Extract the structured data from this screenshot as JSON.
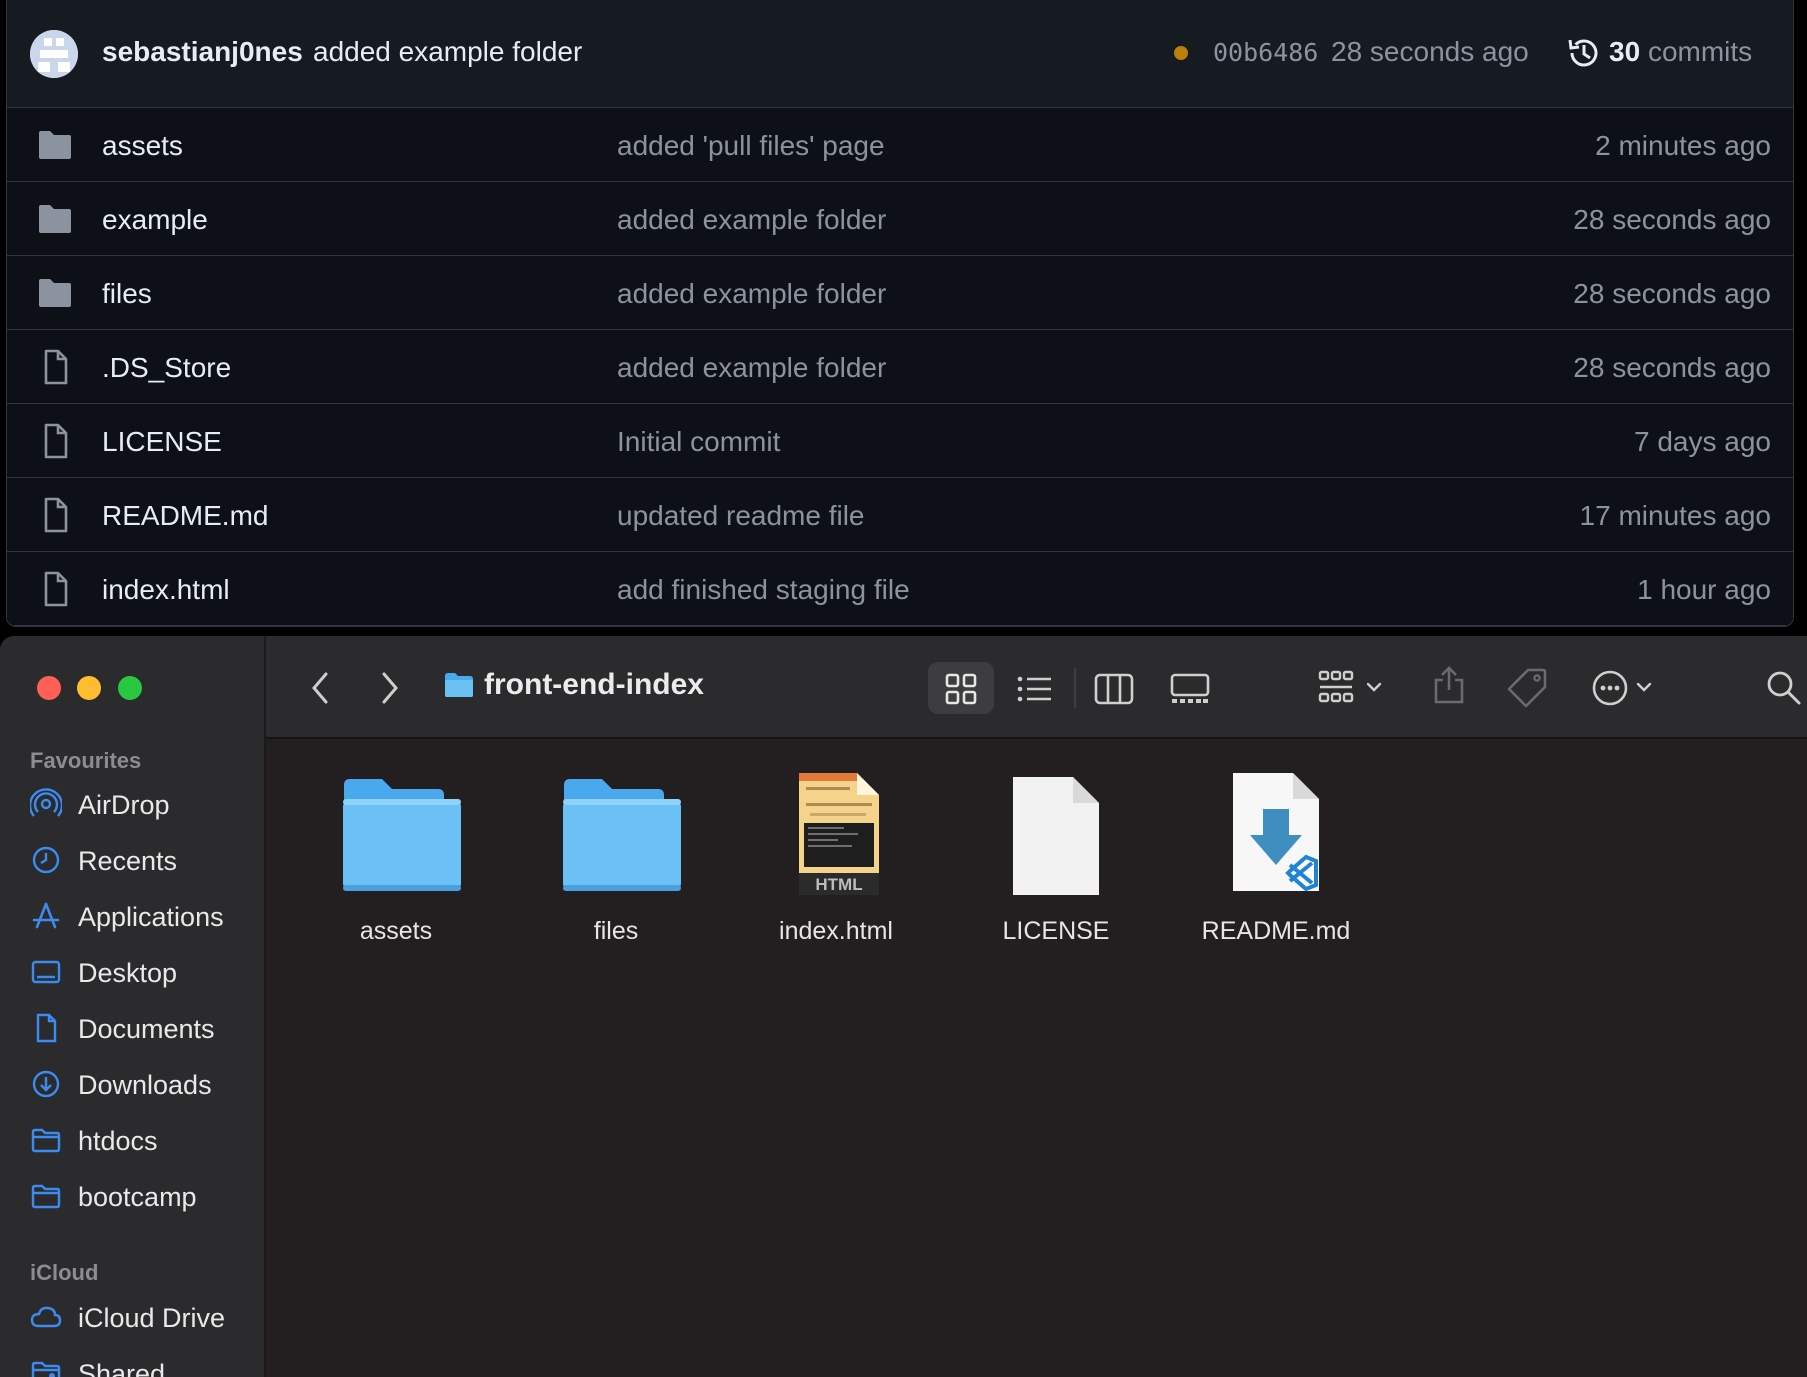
{
  "github": {
    "last_commit": {
      "author": "sebastianj0nes",
      "message": "added example folder",
      "sha": "00b6486",
      "time": "28 seconds ago",
      "commits_count": "30",
      "commits_label": "commits"
    },
    "files": [
      {
        "name": "assets",
        "type": "folder",
        "message": "added 'pull files' page",
        "age": "2 minutes ago"
      },
      {
        "name": "example",
        "type": "folder",
        "message": "added example folder",
        "age": "28 seconds ago"
      },
      {
        "name": "files",
        "type": "folder",
        "message": "added example folder",
        "age": "28 seconds ago"
      },
      {
        "name": ".DS_Store",
        "type": "file",
        "message": "added example folder",
        "age": "28 seconds ago"
      },
      {
        "name": "LICENSE",
        "type": "file",
        "message": "Initial commit",
        "age": "7 days ago"
      },
      {
        "name": "README.md",
        "type": "file",
        "message": "updated readme file",
        "age": "17 minutes ago"
      },
      {
        "name": "index.html",
        "type": "file",
        "message": "add finished staging file",
        "age": "1 hour ago"
      }
    ]
  },
  "finder": {
    "folder_title": "front-end-index",
    "sidebar": {
      "favourites_label": "Favourites",
      "favourites": [
        {
          "label": "AirDrop",
          "icon": "airdrop-icon"
        },
        {
          "label": "Recents",
          "icon": "clock-icon"
        },
        {
          "label": "Applications",
          "icon": "applications-icon"
        },
        {
          "label": "Desktop",
          "icon": "desktop-icon"
        },
        {
          "label": "Documents",
          "icon": "document-icon"
        },
        {
          "label": "Downloads",
          "icon": "download-icon"
        },
        {
          "label": "htdocs",
          "icon": "folder-icon"
        },
        {
          "label": "bootcamp",
          "icon": "folder-icon"
        }
      ],
      "icloud_label": "iCloud",
      "icloud": [
        {
          "label": "iCloud Drive",
          "icon": "cloud-icon"
        },
        {
          "label": "Shared",
          "icon": "shared-folder-icon"
        }
      ]
    },
    "items": [
      {
        "label": "assets",
        "kind": "folder"
      },
      {
        "label": "files",
        "kind": "folder"
      },
      {
        "label": "index.html",
        "kind": "html"
      },
      {
        "label": "LICENSE",
        "kind": "document"
      },
      {
        "label": "README.md",
        "kind": "markdown"
      }
    ],
    "html_thumb_badge": "HTML",
    "colors": {
      "close": "#ff5f57",
      "minimize": "#febc2e",
      "zoom": "#28c840",
      "accent": "#3b8cf1",
      "folder": "#6bc1f4"
    }
  }
}
